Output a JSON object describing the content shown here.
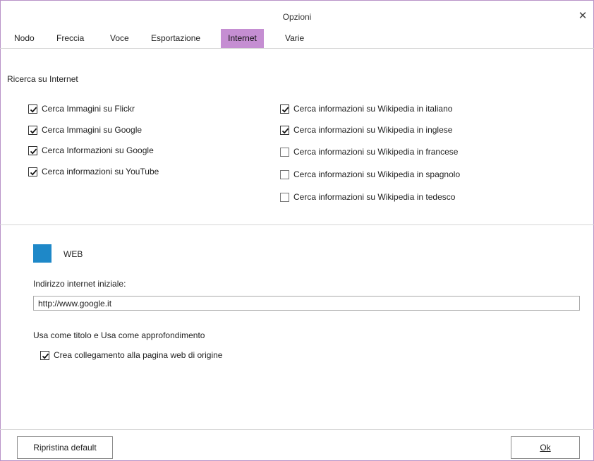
{
  "window": {
    "title": "Opzioni",
    "close_glyph": "✕"
  },
  "tabs": [
    {
      "label": "Nodo",
      "active": false
    },
    {
      "label": "Freccia",
      "active": false
    },
    {
      "label": "Voce",
      "active": false
    },
    {
      "label": "Esportazione",
      "active": false
    },
    {
      "label": "Internet",
      "active": true
    },
    {
      "label": "Varie",
      "active": false
    }
  ],
  "internet_search": {
    "heading": "Ricerca su Internet",
    "left_options": [
      {
        "label": "Cerca Immagini su Flickr",
        "checked": true
      },
      {
        "label": "Cerca Immagini su Google",
        "checked": true
      },
      {
        "label": "Cerca Informazioni su Google",
        "checked": true
      },
      {
        "label": "Cerca informazioni su YouTube",
        "checked": true
      }
    ],
    "right_options": [
      {
        "label": "Cerca informazioni su Wikipedia in italiano",
        "checked": true
      },
      {
        "label": "Cerca informazioni su Wikipedia in inglese",
        "checked": true
      },
      {
        "label": "Cerca informazioni su Wikipedia in francese",
        "checked": false
      },
      {
        "label": "Cerca informazioni su Wikipedia in spagnolo",
        "checked": false
      },
      {
        "label": "Cerca informazioni su Wikipedia in tedesco",
        "checked": false
      }
    ]
  },
  "web": {
    "swatch_label": "WEB",
    "swatch_color": "#1e88c8",
    "start_url_label": "Indirizzo internet iniziale:",
    "start_url_value": "http://www.google.it",
    "usage_label": "Usa come titolo e Usa come approfondimento",
    "link_option": {
      "label": "Crea collegamento alla pagina web di origine",
      "checked": true
    }
  },
  "buttons": {
    "reset_label": "Ripristina default",
    "ok_label": "Ok"
  },
  "colors": {
    "active_tab": "#c58ed2",
    "window_border": "#b892c8"
  }
}
